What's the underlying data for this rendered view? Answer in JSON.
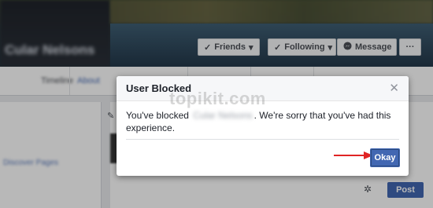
{
  "background": {
    "profile_name": "Cular Nelsons",
    "buttons": {
      "friends": "Friends",
      "following": "Following",
      "message": "Message",
      "more": "···"
    },
    "tabs": [
      "Timeline",
      "About"
    ],
    "left_link": "Discover Pages",
    "post_button": "Post"
  },
  "dialog": {
    "title": "User Blocked",
    "message_before": "You've blocked",
    "blocked_name": "Cular Nelsons",
    "message_after": ". We're sorry that you've had this experience.",
    "okay_label": "Okay"
  },
  "watermark": "topikit.com",
  "colors": {
    "accent": "#4267b2",
    "arrow": "#e02424"
  }
}
